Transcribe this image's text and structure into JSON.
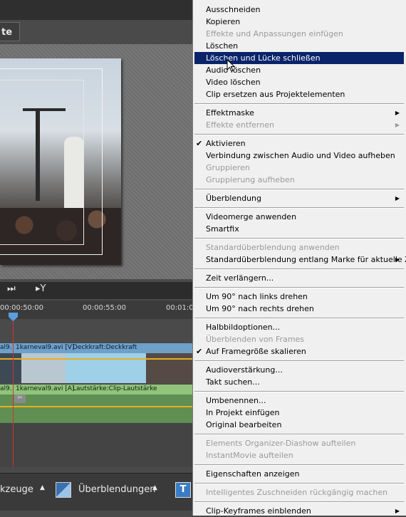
{
  "editor": {
    "top_button_label": "te",
    "ruler_ticks": [
      "00:00:50:00",
      "00:00:55:00",
      "00:01:0"
    ],
    "video_track": {
      "clip_short": "al9.",
      "clip_name": "1karneval9.avi [V]",
      "property": "Deckkraft:Deckkraft"
    },
    "audio_track": {
      "clip_short": "al9.",
      "clip_name": "1karneval9.avi [A]",
      "property": "Lautstärke:Clip-Lautstärke"
    },
    "bottom_bar": {
      "tools_label": "kzeuge",
      "transitions_label": "Überblendungen"
    }
  },
  "menu": {
    "items": [
      {
        "label": "Ausschneiden",
        "disabled": false
      },
      {
        "label": "Kopieren",
        "disabled": false
      },
      {
        "label": "Effekte und Anpassungen einfügen",
        "disabled": true
      },
      {
        "label": "Löschen",
        "disabled": false
      },
      {
        "label": "Löschen und Lücke schließen",
        "disabled": false,
        "highlighted": true
      },
      {
        "label": "Audio löschen",
        "disabled": false
      },
      {
        "label": "Video löschen",
        "disabled": false
      },
      {
        "label": "Clip ersetzen aus Projektelementen",
        "disabled": false
      },
      {
        "label": "Effektmaske",
        "disabled": false,
        "submenu": true
      },
      {
        "label": "Effekte entfernen",
        "disabled": true,
        "submenu": true
      },
      {
        "label": "Aktivieren",
        "disabled": false,
        "checked": true
      },
      {
        "label": "Verbindung zwischen Audio und Video aufheben",
        "disabled": false
      },
      {
        "label": "Gruppieren",
        "disabled": true
      },
      {
        "label": "Gruppierung aufheben",
        "disabled": true
      },
      {
        "label": "Überblendung",
        "disabled": false,
        "submenu": true
      },
      {
        "label": "Videomerge anwenden",
        "disabled": false
      },
      {
        "label": "Smartfix",
        "disabled": false
      },
      {
        "label": "Standardüberblendung anwenden",
        "disabled": true
      },
      {
        "label": "Standardüberblendung entlang Marke für aktuelle Zeit",
        "disabled": false,
        "submenu": true
      },
      {
        "label": "Zeit verlängern...",
        "disabled": false
      },
      {
        "label": "Um 90° nach links drehen",
        "disabled": false
      },
      {
        "label": "Um 90° nach rechts drehen",
        "disabled": false
      },
      {
        "label": "Halbbildoptionen...",
        "disabled": false
      },
      {
        "label": "Überblenden von Frames",
        "disabled": true
      },
      {
        "label": "Auf Framegröße skalieren",
        "disabled": false,
        "checked": true
      },
      {
        "label": "Audioverstärkung...",
        "disabled": false
      },
      {
        "label": "Takt suchen...",
        "disabled": false
      },
      {
        "label": "Umbenennen...",
        "disabled": false
      },
      {
        "label": "In Projekt einfügen",
        "disabled": false
      },
      {
        "label": "Original bearbeiten",
        "disabled": false
      },
      {
        "label": "Elements Organizer-Diashow aufteilen",
        "disabled": true
      },
      {
        "label": "InstantMovie aufteilen",
        "disabled": true
      },
      {
        "label": "Eigenschaften anzeigen",
        "disabled": false
      },
      {
        "label": "Intelligentes Zuschneiden rückgängig machen",
        "disabled": true
      },
      {
        "label": "Clip-Keyframes einblenden",
        "disabled": false,
        "submenu": true
      }
    ]
  },
  "icons": {
    "check": "checkmark-icon",
    "submenu": "submenu-arrow-icon",
    "step_forward": "step-forward-icon",
    "marker": "marker-icon",
    "text_tool": "text-tool-icon",
    "scissors": "scissors-icon"
  },
  "colors": {
    "menu_bg": "#f0f0f0",
    "menu_highlight": "#0a246a",
    "disabled_text": "#9a9a9a",
    "playhead": "#d43030",
    "video_track": "#6ea0c8",
    "audio_track": "#8fc47a"
  }
}
